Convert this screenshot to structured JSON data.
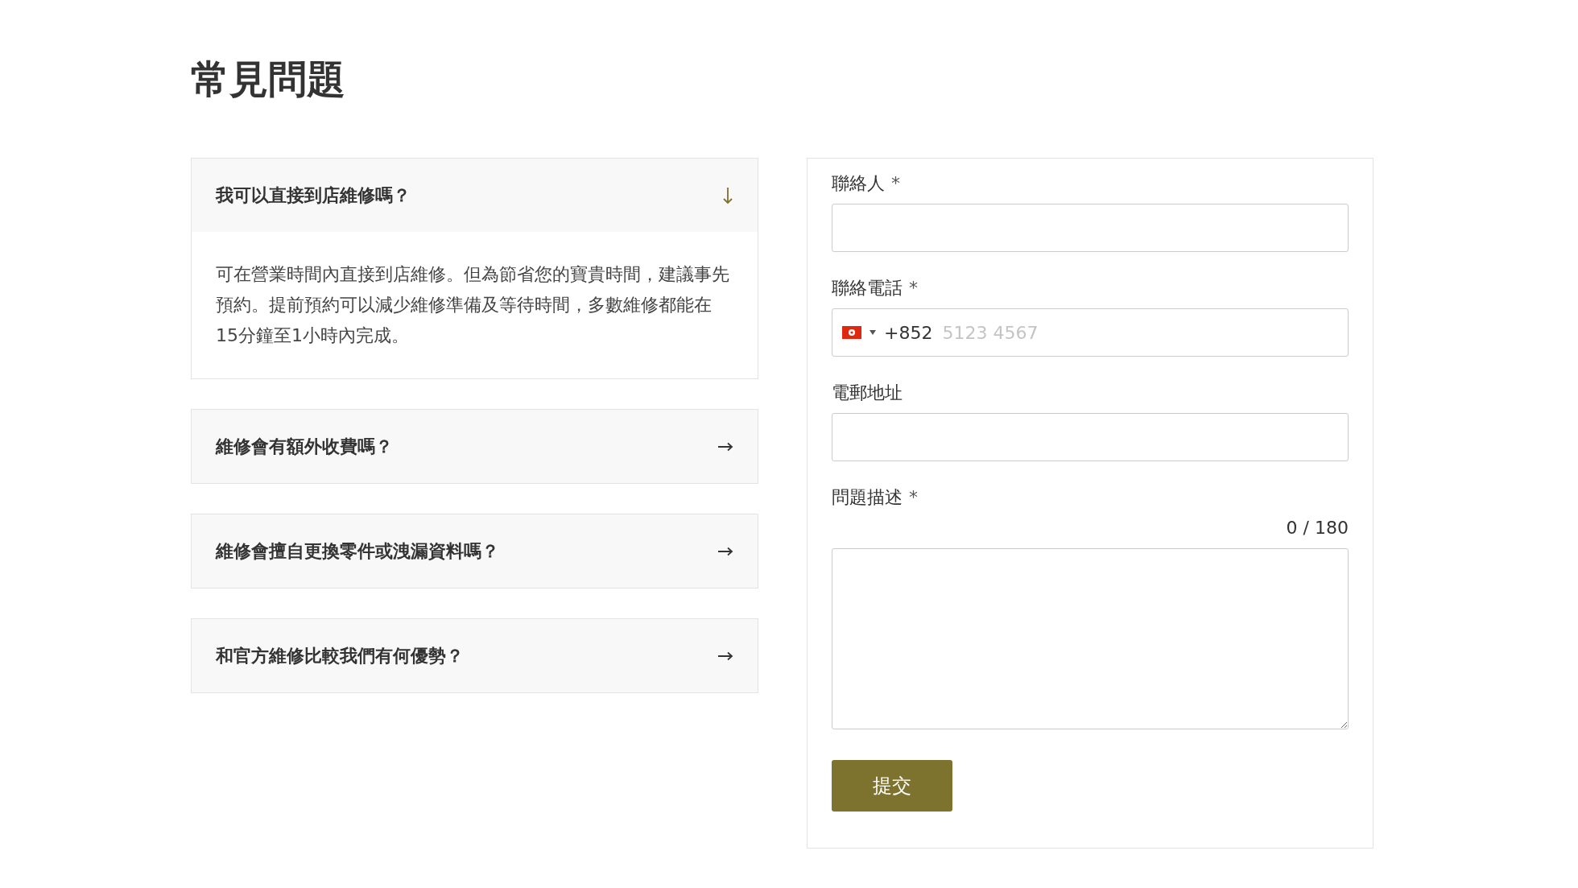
{
  "title": "常見問題",
  "faq": [
    {
      "question": "我可以直接到店維修嗎？",
      "expanded": true,
      "answer": "可在營業時間內直接到店維修。但為節省您的寶貴時間，建議事先預約。提前預約可以減少維修準備及等待時間，多數維修都能在15分鐘至1小時內完成。"
    },
    {
      "question": "維修會有額外收費嗎？",
      "expanded": false
    },
    {
      "question": "維修會擅自更換零件或洩漏資料嗎？",
      "expanded": false
    },
    {
      "question": "和官方維修比較我們有何優勢？",
      "expanded": false
    }
  ],
  "form": {
    "fields": [
      {
        "kind": "text",
        "label": "聯絡人",
        "required_mark": "*"
      },
      {
        "kind": "phone",
        "label": "聯絡電話",
        "required_mark": "*",
        "dial_code": "+852",
        "placeholder": "5123 4567"
      },
      {
        "kind": "text",
        "label": "電郵地址"
      },
      {
        "kind": "textarea",
        "label": "問題描述",
        "required_mark": "*",
        "counter": "0 / 180"
      }
    ],
    "submit": "提交"
  }
}
